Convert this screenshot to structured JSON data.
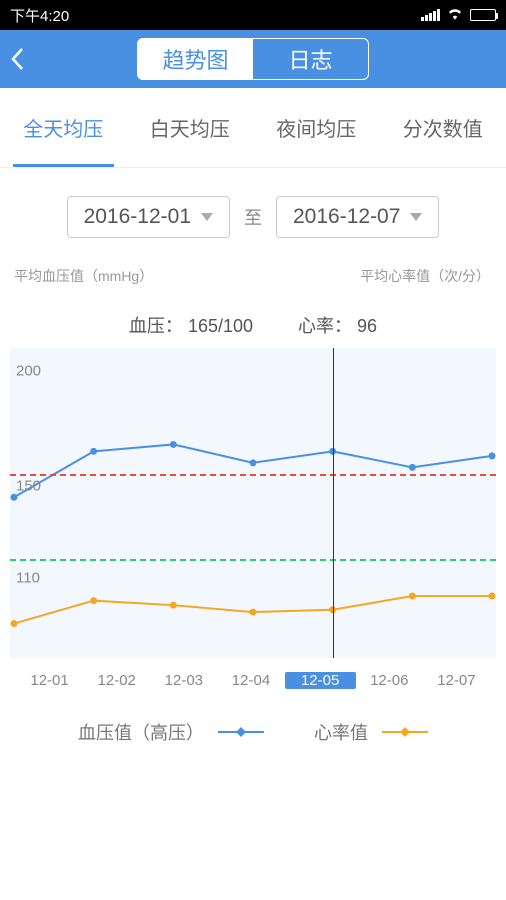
{
  "status_bar": {
    "time": "下午4:20"
  },
  "top_nav": {
    "segments": [
      {
        "label": "趋势图",
        "active": true
      },
      {
        "label": "日志",
        "active": false
      }
    ]
  },
  "sub_tabs": [
    {
      "label": "全天均压",
      "active": true
    },
    {
      "label": "白天均压",
      "active": false
    },
    {
      "label": "夜间均压",
      "active": false
    },
    {
      "label": "分次数值",
      "active": false
    }
  ],
  "date_range": {
    "from": "2016-12-01",
    "to_label": "至",
    "to": "2016-12-07"
  },
  "axis_titles": {
    "left": "平均血压值（mmHg）",
    "right": "平均心率值（次/分）"
  },
  "readout": {
    "bp_label": "血压：",
    "bp_value": "165/100",
    "hr_label": "心率：",
    "hr_value": "96"
  },
  "legend": {
    "bp": "血压值（高压）",
    "hr": "心率值"
  },
  "chart_data": {
    "type": "line",
    "categories": [
      "12-01",
      "12-02",
      "12-03",
      "12-04",
      "12-05",
      "12-06",
      "12-07"
    ],
    "selected_index": 4,
    "y_ticks": [
      200,
      150,
      110
    ],
    "y_range": [
      75,
      210
    ],
    "reference_lines": [
      {
        "value": 155,
        "color": "#e74c3c"
      },
      {
        "value": 118,
        "color": "#2ecc71"
      }
    ],
    "series": [
      {
        "name": "血压值（高压）",
        "color": "#4a90e2",
        "values": [
          145,
          165,
          168,
          160,
          165,
          158,
          163
        ]
      },
      {
        "name": "心率值",
        "color": "#f5a623",
        "values": [
          90,
          100,
          98,
          95,
          96,
          102,
          102
        ]
      }
    ]
  }
}
